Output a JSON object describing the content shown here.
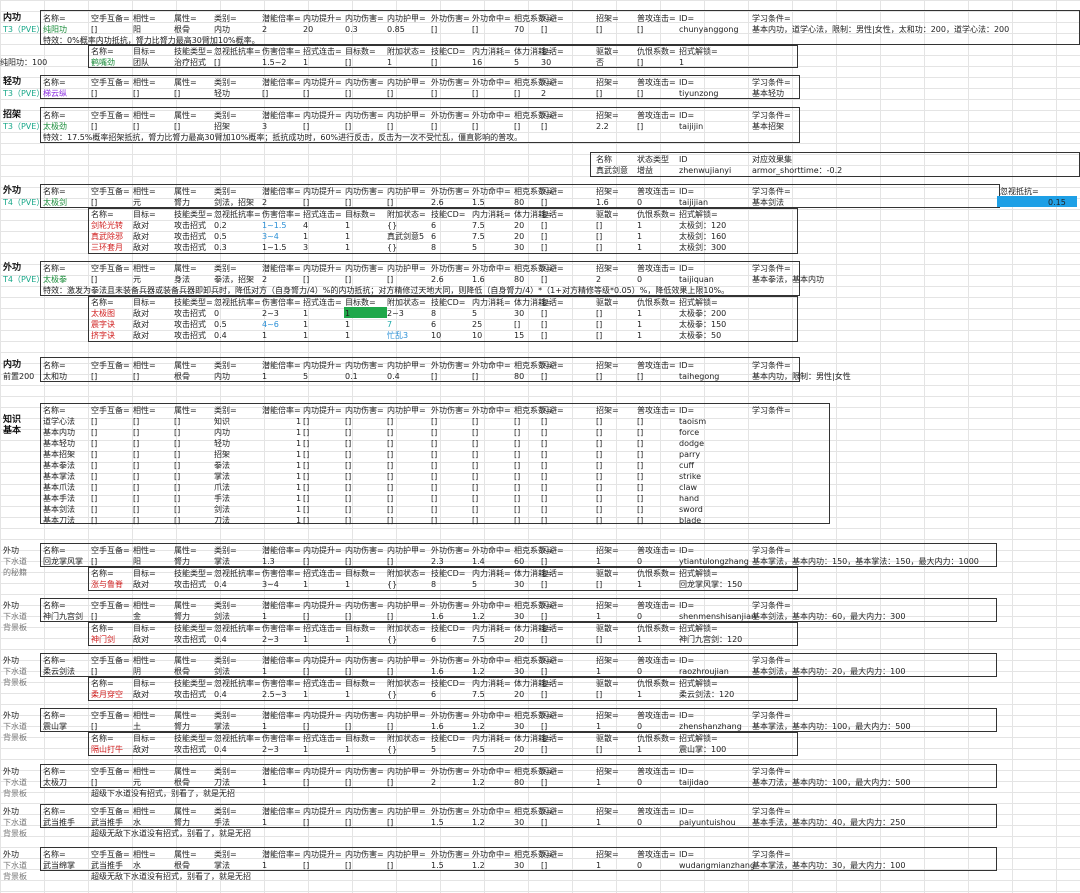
{
  "hdr": {
    "name": "名称=",
    "kong": "空手互备=",
    "xx": "相性=",
    "attr": "属性=",
    "cat": "类别=",
    "qn": "潜能倍率=",
    "nt": "内功提升=",
    "nsh": "内功伤害=",
    "nhj": "内功护甲=",
    "wsh": "外功伤害=",
    "wmz": "外功命中=",
    "xk": "相克系数=",
    "sb": "闪避=",
    "zj": "招架=",
    "pg": "普攻连击=",
    "id": "ID=",
    "xx2": "学习条件="
  },
  "shdr": {
    "name": "名称=",
    "tgt": "目标=",
    "jn": "技能类型=",
    "hs": "忽视抵抗率=",
    "sl": "伤害倍率=",
    "zs": "招式连击=",
    "mb": "目标数=",
    "fj": "附加状态=",
    "cd": "技能CD=",
    "nl": "内力消耗=",
    "tl": "体力消耗=",
    "fh": "复活=",
    "qs": "驱散=",
    "ch": "仇恨系数=",
    "zj": "招式解锁="
  },
  "sections": {
    "neigong": {
      "title": "内功",
      "tier": "T3（PVE）"
    },
    "qinggong": {
      "title": "轻功",
      "tier": "T3（PVE）"
    },
    "zhaojia": {
      "title": "招架",
      "tier": "T3（PVE）"
    },
    "waigong1": {
      "title": "外功",
      "tier": "T4（PVE）"
    },
    "waigong2": {
      "title": "外功",
      "tier": "T4（PVE）"
    },
    "neigong2": {
      "title": "内功",
      "tier": "前置200"
    },
    "zhishi": {
      "title": "知识",
      "tier": "基本"
    }
  },
  "r1": [
    "纯阳功",
    "[]",
    "阳",
    "根骨",
    "内功",
    "2",
    "20",
    "0.3",
    "0.85",
    "[]",
    "[]",
    "70",
    "[]",
    "[]",
    "[]",
    "chunyanggong",
    "基本内功，道学心法，限制：男性|女性，太和功：200，道学心法：200"
  ],
  "r1note": "特效：0%概率内功抵抗，膂力比膂力最高30臂加10%概率。",
  "r1s": [
    "鹤嘴劲",
    "团队",
    "治疗招式",
    "[]",
    "1.5~2",
    "1",
    "[]",
    "1",
    "[]",
    "16",
    "5",
    "30",
    "否",
    "[]",
    "1",
    "纯阳功：100"
  ],
  "r2": [
    "梯云纵",
    "[]",
    "[]",
    "[]",
    "轻功",
    "[]",
    "[]",
    "[]",
    "[]",
    "[]",
    "[]",
    "[]",
    "2",
    "[]",
    "[]",
    "tiyunzong",
    "基本轻功"
  ],
  "r3": [
    "太极劲",
    "[]",
    "[]",
    "[]",
    "招架",
    "3",
    "[]",
    "[]",
    "[]",
    "[]",
    "[]",
    "[]",
    "[]",
    "2.2",
    "[]",
    "taijijin",
    "基本招架"
  ],
  "r3note": "特效：17.5%概率招架抵抗，膂力比膂力最高30臂加10%概率；抵抗成功时，60%进行反击，反击为一次不受忙乱，僵直影响的普攻。",
  "eff": {
    "h1": "名称",
    "h2": "状态类型",
    "h3": "ID",
    "h4": "对应效果集",
    "v1": "真武剑意",
    "v2": "增益",
    "v3": "zhenwujianyi",
    "v4": "armor_shorttime：-0.2"
  },
  "r4": [
    "太极剑",
    "[]",
    "元",
    "膂力",
    "剑法，招架",
    "2",
    "[]",
    "[]",
    "[]",
    "2.6",
    "1.5",
    "80",
    "[]",
    "1.6",
    "0",
    "taijijian",
    "基本剑法"
  ],
  "r4x": {
    "h": "忽视抵抗=",
    "v": "0.15"
  },
  "r4s": [
    [
      "剑轮光转",
      "敌对",
      "攻击招式",
      "0.2",
      "1~1.5",
      "4",
      "1",
      "{}",
      "6",
      "7.5",
      "20",
      "[]",
      "[]",
      "1",
      "太极剑：120"
    ],
    [
      "真武除邪",
      "敌对",
      "攻击招式",
      "0.5",
      "3~4",
      "1",
      "1",
      "真武剑意5",
      "6",
      "7.5",
      "20",
      "[]",
      "[]",
      "1",
      "太极剑：160"
    ],
    [
      "三环套月",
      "敌对",
      "攻击招式",
      "0.3",
      "1~1.5",
      "3",
      "1",
      "{}",
      "8",
      "5",
      "30",
      "[]",
      "[]",
      "1",
      "太极剑：300"
    ]
  ],
  "r5": [
    "太极拳",
    "[]",
    "元",
    "身法",
    "拳法，招架",
    "2",
    "[]",
    "[]",
    "[]",
    "2.6",
    "1.6",
    "80",
    "[]",
    "2",
    "0",
    "taijiquan",
    "基本拳法，基本内功"
  ],
  "r5note": "特效：激发为拳法且未装备兵器或装备兵器即卸兵时，降低对方（自身膂力/4）%的内功抵抗；对方精修过天地大同，则降低（自身膂力/4）*（1+对方精修等级*0.05）%，降低效果上限10%。",
  "r5s": [
    [
      "太极图",
      "敌对",
      "攻击招式",
      "0",
      "2~3",
      "1",
      "1",
      "2~3",
      "8",
      "5",
      "30",
      "[]",
      "[]",
      "1",
      "太极拳：200"
    ],
    [
      "震字诀",
      "敌对",
      "攻击招式",
      "0.5",
      "4~6",
      "1",
      "1",
      "7",
      "6",
      "25",
      "[]",
      "[]",
      "[]",
      "1",
      "太极拳：150"
    ],
    [
      "挤字诀",
      "敌对",
      "攻击招式",
      "0.4",
      "1",
      "1",
      "1",
      "忙乱3",
      "10",
      "10",
      "15",
      "[]",
      "[]",
      "1",
      "太极拳：50"
    ]
  ],
  "r6": [
    "太和功",
    "[]",
    "[]",
    "根骨",
    "内功",
    "1",
    "5",
    "0.1",
    "0.4",
    "[]",
    "[]",
    "80",
    "[]",
    "[]",
    "[]",
    "taihegong",
    "基本内功，限制：男性|女性"
  ],
  "kn": [
    [
      "道学心法",
      "知识",
      "taoism"
    ],
    [
      "基本内功",
      "内功",
      "force"
    ],
    [
      "基本轻功",
      "轻功",
      "dodge"
    ],
    [
      "基本招架",
      "招架",
      "parry"
    ],
    [
      "基本拳法",
      "拳法",
      "cuff"
    ],
    [
      "基本掌法",
      "掌法",
      "strike"
    ],
    [
      "基本爪法",
      "爪法",
      "claw"
    ],
    [
      "基本手法",
      "手法",
      "hand"
    ],
    [
      "基本剑法",
      "剑法",
      "sword"
    ],
    [
      "基本刀法",
      "刀法",
      "blade"
    ]
  ],
  "kn_one": "1",
  "kn_br": "[]",
  "kn_br2": "{}",
  "lower": [
    {
      "a": "外功",
      "b": "下水道",
      "c": "的秘籍",
      "row": [
        "回龙掌风掌",
        "[]",
        "阳",
        "膂力",
        "掌法",
        "1.3",
        "[]",
        "[]",
        "[]",
        "2.3",
        "1.4",
        "60",
        "[]",
        "1",
        "0",
        "ytiantulongzhang",
        "基本掌法，基本内功：150，基本掌法：150，最大内力：1000"
      ],
      "sub": [
        "涨与鲁脊",
        "敌对",
        "攻击招式",
        "0.4",
        "3~4",
        "1",
        "1",
        "{}",
        "8",
        "5",
        "30",
        "[]",
        "[]",
        "1",
        "回龙掌风掌：150"
      ]
    },
    {
      "a": "外功",
      "b": "下水道",
      "c": "背景板",
      "row": [
        "神门九宫剑",
        "[]",
        "金",
        "膂力",
        "剑法",
        "1",
        "[]",
        "[]",
        "[]",
        "1.6",
        "1.2",
        "30",
        "[]",
        "1",
        "0",
        "shenmenshisanjian",
        "基本剑法，基本内功：60，最大内力：300"
      ],
      "sub": [
        "神门剑",
        "敌对",
        "攻击招式",
        "0.4",
        "2~3",
        "1",
        "1",
        "{}",
        "6",
        "7.5",
        "20",
        "[]",
        "[]",
        "1",
        "神门九宫剑：120"
      ]
    },
    {
      "a": "外功",
      "b": "下水道",
      "c": "背景板",
      "row": [
        "柔云剑法",
        "[]",
        "阴",
        "根骨",
        "剑法",
        "1",
        "[]",
        "[]",
        "[]",
        "1.6",
        "1.2",
        "30",
        "[]",
        "1",
        "0",
        "raozhroujian",
        "基本剑法，基本内功：20，最大内力：100"
      ],
      "sub": [
        "柔月穿空",
        "敌对",
        "攻击招式",
        "0.4",
        "2.5~3",
        "1",
        "1",
        "{}",
        "6",
        "7.5",
        "20",
        "[]",
        "[]",
        "1",
        "柔云剑法：120"
      ]
    },
    {
      "a": "外功",
      "b": "下水道",
      "c": "背景板",
      "row": [
        "震山掌",
        "[]",
        "土",
        "膂力",
        "掌法",
        "1",
        "[]",
        "[]",
        "[]",
        "1.6",
        "1.2",
        "30",
        "[]",
        "1",
        "0",
        "zhenshanzhang",
        "基本掌法，基本内功：100，最大内力：500"
      ],
      "sub": [
        "隔山打牛",
        "敌对",
        "攻击招式",
        "0.4",
        "2~3",
        "1",
        "1",
        "{}",
        "5",
        "7.5",
        "20",
        "[]",
        "[]",
        "1",
        "震山掌：100"
      ]
    },
    {
      "a": "外功",
      "b": "下水道",
      "c": "背景板",
      "row": [
        "太极刀",
        "[]",
        "元",
        "根骨",
        "刀法",
        "1",
        "[]",
        "[]",
        "[]",
        "2",
        "1.2",
        "80",
        "[]",
        "1",
        "0",
        "taijidao",
        "基本刀法，基本内功：100，最大内力：500"
      ],
      "note": "超级下水道没有招式，别看了，就是无招"
    },
    {
      "a": "外功",
      "b": "下水道",
      "c": "背景板",
      "row": [
        "武当推手",
        "武当推手",
        "水",
        "膂力",
        "手法",
        "1",
        "[]",
        "[]",
        "[]",
        "1.5",
        "1.2",
        "30",
        "[]",
        "1",
        "0",
        "paiyuntuishou",
        "基本手法，基本内功：40，最大内力：250"
      ],
      "note": "超级无敌下水道没有招式，别看了，就是无招"
    },
    {
      "a": "外功",
      "b": "下水道",
      "c": "背景板",
      "row": [
        "武当绵掌",
        "武当推手",
        "水",
        "根骨",
        "掌法",
        "1",
        "[]",
        "[]",
        "[]",
        "1.5",
        "1.2",
        "30",
        "[]",
        "1",
        "0",
        "wudangmianzhang",
        "基本掌法，基本内功：30，最大内力：100"
      ],
      "note": "超级无敌下水道没有招式，别看了，就是无招"
    }
  ],
  "colors": {
    "green": "#1a8c3a",
    "blue_fill": "#1ea0e6",
    "green_fill": "#1fa84a"
  }
}
